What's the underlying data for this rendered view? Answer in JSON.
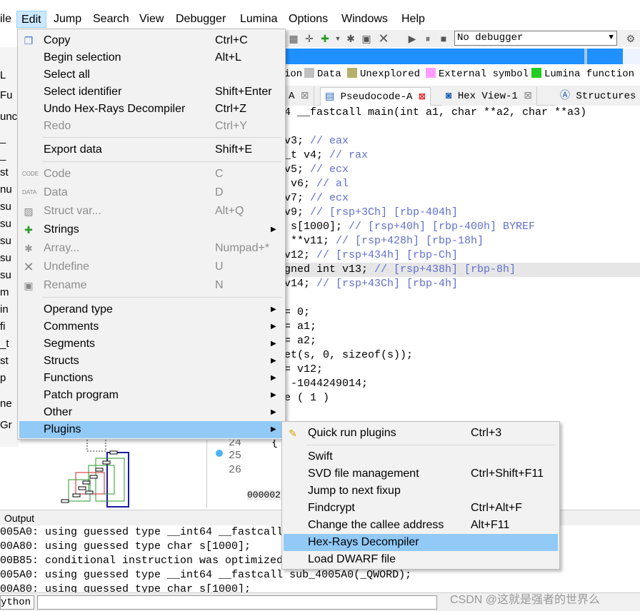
{
  "menubar": {
    "file_label": "ile",
    "edit_label": "Edit",
    "jump_label": "Jump",
    "search_label": "Search",
    "view_label": "View",
    "debugger_label": "Debugger",
    "lumina_label": "Lumina",
    "options_label": "Options",
    "windows_label": "Windows",
    "help_label": "Help"
  },
  "toolbar": {
    "debugger_select": "No debugger"
  },
  "legend": {
    "items": [
      {
        "label": "ion",
        "color": ""
      },
      {
        "label": "Data",
        "color": "#c0c0c0"
      },
      {
        "label": "Unexplored",
        "color": "#b5b06a"
      },
      {
        "label": "External symbol",
        "color": "#ff9dff"
      },
      {
        "label": "Lumina function",
        "color": "#22cc22"
      }
    ]
  },
  "tabs": {
    "partial": "A",
    "pseudocode": "Pseudocode-A",
    "hexview": "Hex View-1",
    "structures": "Structures"
  },
  "code": {
    "lines": [
      "4 __fastcall main(int a1, char **a2, char **a3)",
      "",
      "v3; // eax",
      "_t v4; // rax",
      "v5; // ecx",
      " v6; // al",
      "v7; // ecx",
      "v9; // [rsp+3Ch] [rbp-404h]",
      " s[1000]; // [rsp+40h] [rbp-400h] BYREF",
      " **v11; // [rsp+428h] [rbp-18h]",
      "v12; // [rsp+434h] [rbp-Ch]",
      "gned int v13; // [rsp+438h] [rbp-8h]",
      "v14; // [rsp+43Ch] [rbp-4h]",
      "",
      "= 0;",
      "= a1;",
      "= a2;",
      "et(s, 0, sizeof(s));",
      "= v12;",
      " -1044249014;",
      "e ( 1 )"
    ],
    "brace": "{"
  },
  "line_numbers": [
    "24",
    "25",
    "26"
  ],
  "address_prefix": "000002",
  "left_panel": {
    "items": [
      "L",
      "Fu",
      "unc",
      "_",
      "_",
      "st",
      "nu",
      "su",
      "su",
      "su",
      "su",
      "su",
      "m",
      "in",
      "fi",
      "_t",
      "st",
      "p",
      "ne",
      "Gr"
    ]
  },
  "output": {
    "title": "Output",
    "lines": [
      "005A0: using guessed type __int64 __fastcall",
      "00A80: using guessed type char s[1000];",
      "00B85: conditional instruction was optimized",
      "005A0: using guessed type __int64 __fastcall sub_4005A0(_QWORD);",
      "00A80: using guessed type char s[1000];"
    ]
  },
  "cmdbar": {
    "python_label": "ython"
  },
  "watermark": "CSDN @这就是强者的世界么",
  "edit_menu": {
    "copy": {
      "label": "Copy",
      "shortcut": "Ctrl+C"
    },
    "begin_selection": {
      "label": "Begin selection",
      "shortcut": "Alt+L"
    },
    "select_all": {
      "label": "Select all",
      "shortcut": ""
    },
    "select_identifier": {
      "label": "Select identifier",
      "shortcut": "Shift+Enter"
    },
    "undo": {
      "label": "Undo Hex-Rays Decompiler",
      "shortcut": "Ctrl+Z"
    },
    "redo": {
      "label": "Redo",
      "shortcut": "Ctrl+Y"
    },
    "export_data": {
      "label": "Export data",
      "shortcut": "Shift+E"
    },
    "code": {
      "label": "Code",
      "shortcut": "C"
    },
    "data": {
      "label": "Data",
      "shortcut": "D"
    },
    "struct_var": {
      "label": "Struct var...",
      "shortcut": "Alt+Q"
    },
    "strings": {
      "label": "Strings",
      "shortcut": ""
    },
    "array": {
      "label": "Array...",
      "shortcut": "Numpad+*"
    },
    "undefine": {
      "label": "Undefine",
      "shortcut": "U"
    },
    "rename": {
      "label": "Rename",
      "shortcut": "N"
    },
    "operand_type": {
      "label": "Operand type"
    },
    "comments": {
      "label": "Comments"
    },
    "segments": {
      "label": "Segments"
    },
    "structs": {
      "label": "Structs"
    },
    "functions": {
      "label": "Functions"
    },
    "patch_program": {
      "label": "Patch program"
    },
    "other": {
      "label": "Other"
    },
    "plugins": {
      "label": "Plugins"
    }
  },
  "plugins_menu": {
    "quick_run": {
      "label": "Quick run plugins",
      "shortcut": "Ctrl+3"
    },
    "swift": {
      "label": "Swift",
      "shortcut": ""
    },
    "svd": {
      "label": "SVD file management",
      "shortcut": "Ctrl+Shift+F11"
    },
    "jump_fixup": {
      "label": "Jump to next fixup",
      "shortcut": ""
    },
    "findcrypt": {
      "label": "Findcrypt",
      "shortcut": "Ctrl+Alt+F"
    },
    "callee": {
      "label": "Change the callee address",
      "shortcut": "Alt+F11"
    },
    "hexrays": {
      "label": "Hex-Rays Decompiler",
      "shortcut": ""
    },
    "dwarf": {
      "label": "Load DWARF file",
      "shortcut": ""
    }
  },
  "colors": {
    "menu_highlight": "#91c9f7",
    "nav_band": "#1e90ff",
    "comment": "#6070d0"
  }
}
